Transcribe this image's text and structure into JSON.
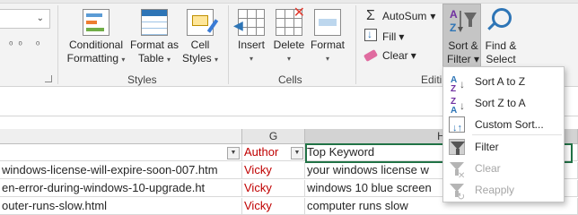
{
  "ribbon": {
    "styles_group": {
      "label": "Styles",
      "conditional_formatting": [
        "Conditional",
        "Formatting"
      ],
      "format_as_table": [
        "Format as",
        "Table"
      ],
      "cell_styles": [
        "Cell",
        "Styles"
      ]
    },
    "cells_group": {
      "label": "Cells",
      "insert": "Insert",
      "delete": "Delete",
      "format": "Format"
    },
    "editing_group": {
      "label": "Editi",
      "autosum": "AutoSum",
      "fill": "Fill",
      "clear": "Clear",
      "sort_filter": [
        "Sort &",
        "Filter"
      ],
      "find_select": [
        "Find &",
        "Select"
      ]
    }
  },
  "sheet": {
    "column_g": "G",
    "column_h": "H",
    "header_row": {
      "author": "Author",
      "top_keyword": "Top Keyword"
    },
    "rows": [
      {
        "url": "windows-license-will-expire-soon-007.htm",
        "author": "Vicky",
        "keyword": "your windows license w"
      },
      {
        "url": "en-error-during-windows-10-upgrade.ht",
        "author": "Vicky",
        "keyword": "windows 10 blue screen"
      },
      {
        "url": "outer-runs-slow.html",
        "author": "Vicky",
        "keyword": "computer runs slow"
      }
    ]
  },
  "sort_filter_menu": {
    "items": [
      {
        "label": "Sort A to Z",
        "icon": "sort-a-to-z-icon",
        "enabled": true
      },
      {
        "label": "Sort Z to A",
        "icon": "sort-z-to-a-icon",
        "enabled": true
      },
      {
        "label": "Custom Sort...",
        "icon": "custom-sort-icon",
        "enabled": true
      },
      {
        "label": "Filter",
        "icon": "filter-icon",
        "enabled": true
      },
      {
        "label": "Clear",
        "icon": "clear-filter-icon",
        "enabled": false
      },
      {
        "label": "Reapply",
        "icon": "reapply-icon",
        "enabled": false
      }
    ]
  },
  "colors": {
    "author_text": "#c00000",
    "selection_border": "#217346",
    "sort_filter_pressed": "#c5c5c5"
  }
}
